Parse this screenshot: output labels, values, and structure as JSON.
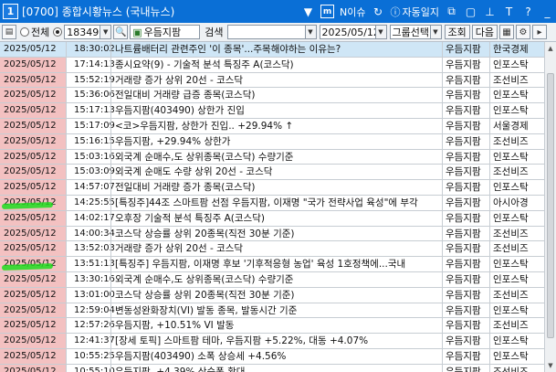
{
  "window": {
    "number": "1",
    "title": "[0700] 종합시황뉴스 (국내뉴스)",
    "buttons": {
      "issue": "N이슈",
      "auto_log": "자동일지",
      "help": "?"
    }
  },
  "toolbar": {
    "radio_all": "전체",
    "code_value": "183490",
    "stock_name": "우듬지팜",
    "search_label": "검색",
    "search_value": "",
    "date_value": "2025/05/12",
    "group_select": "그룹선택",
    "query_button": "조회",
    "next_button": "다음"
  },
  "news": [
    {
      "date": "2025/05/12",
      "time": "18:30:02",
      "title": "나트륨배터리 관련주인 '이 종목'...주목해야하는 이유는?",
      "source": "우듬지팜",
      "publisher": "한국경제"
    },
    {
      "date": "2025/05/12",
      "time": "17:14:13",
      "title": "종시요약(9) - 기술적 분석 특징주 A(코스닥)",
      "source": "우듬지팜",
      "publisher": "인포스탁"
    },
    {
      "date": "2025/05/12",
      "time": "15:52:19",
      "title": "거래량 증가 상위 20선 - 코스닥",
      "source": "우듬지팜",
      "publisher": "조선비즈"
    },
    {
      "date": "2025/05/12",
      "time": "15:36:06",
      "title": "전일대비 거래량 급증 종목(코스닥)",
      "source": "우듬지팜",
      "publisher": "인포스탁"
    },
    {
      "date": "2025/05/12",
      "time": "15:17:13",
      "title": "우듬지팜(403490)  상한가 진입",
      "source": "우듬지팜",
      "publisher": "인포스탁"
    },
    {
      "date": "2025/05/12",
      "time": "15:17:09",
      "title": "<코>우듬지팜, 상한가 진입.. +29.94% ↑",
      "source": "우듬지팜",
      "publisher": "서울경제"
    },
    {
      "date": "2025/05/12",
      "time": "15:16:15",
      "title": "우듬지팜, +29.94% 상한가",
      "source": "우듬지팜",
      "publisher": "조선비즈"
    },
    {
      "date": "2025/05/12",
      "time": "15:03:16",
      "title": "외국계 순매수,도 상위종목(코스닥) 수량기준",
      "source": "우듬지팜",
      "publisher": "인포스탁"
    },
    {
      "date": "2025/05/12",
      "time": "15:03:09",
      "title": "외국계 순매도 수량 상위 20선 - 코스닥",
      "source": "우듬지팜",
      "publisher": "조선비즈"
    },
    {
      "date": "2025/05/12",
      "time": "14:57:07",
      "title": "전일대비 거래량 증가 종목(코스닥)",
      "source": "우듬지팜",
      "publisher": "인포스탁"
    },
    {
      "date": "2025/05/12",
      "time": "14:25:55",
      "title": "[특징주]44조 스마트팜 선점 우듬지팜, 이재명 \"국가 전략사업 육성\"에 부각",
      "source": "우듬지팜",
      "publisher": "아시아경"
    },
    {
      "date": "2025/05/12",
      "time": "14:02:17",
      "title": "오후장 기술적 분석 특징주 A(코스닥)",
      "source": "우듬지팜",
      "publisher": "인포스탁"
    },
    {
      "date": "2025/05/12",
      "time": "14:00:34",
      "title": "코스닥 상승률 상위 20종목(직전 30분 기준)",
      "source": "우듬지팜",
      "publisher": "조선비즈"
    },
    {
      "date": "2025/05/12",
      "time": "13:52:03",
      "title": "거래량 증가 상위 20선 - 코스닥",
      "source": "우듬지팜",
      "publisher": "조선비즈"
    },
    {
      "date": "2025/05/12",
      "time": "13:51:13",
      "title": "[특징주] 우듬지팜, 이재명 후보 '기후적응형 농업' 육성 1호정책에...국내",
      "source": "우듬지팜",
      "publisher": "인포스탁"
    },
    {
      "date": "2025/05/12",
      "time": "13:30:16",
      "title": "외국계 순매수,도 상위종목(코스닥) 수량기준",
      "source": "우듬지팜",
      "publisher": "인포스탁"
    },
    {
      "date": "2025/05/12",
      "time": "13:01:00",
      "title": "코스닥 상승률 상위 20종목(직전 30분 기준)",
      "source": "우듬지팜",
      "publisher": "조선비즈"
    },
    {
      "date": "2025/05/12",
      "time": "12:59:04",
      "title": "변동성완화장치(VI) 발동 종목, 발동시간 기준",
      "source": "우듬지팜",
      "publisher": "인포스탁"
    },
    {
      "date": "2025/05/12",
      "time": "12:57:26",
      "title": "우듬지팜, +10.51% VI 발동",
      "source": "우듬지팜",
      "publisher": "조선비즈"
    },
    {
      "date": "2025/05/12",
      "time": "12:41:37",
      "title": "[장세 토픽] 스마트팜 테마, 우듬지팜 +5.22%, 대동 +4.07%",
      "source": "우듬지팜",
      "publisher": "인포스탁"
    },
    {
      "date": "2025/05/12",
      "time": "10:55:25",
      "title": "우듬지팜(403490) 소폭 상승세 +4.56%",
      "source": "우듬지팜",
      "publisher": "인포스탁"
    },
    {
      "date": "2025/05/12",
      "time": "10:55:10",
      "title": "우듬지팜, +4.39% 상승폭 확대",
      "source": "우듬지팜",
      "publisher": "조선비즈"
    }
  ],
  "colors": {
    "titlebar": "#0a6fd6",
    "date_cell": "#f3c1c1",
    "selected_row": "#cfe6f6",
    "highlighter": "#1edc1e"
  }
}
